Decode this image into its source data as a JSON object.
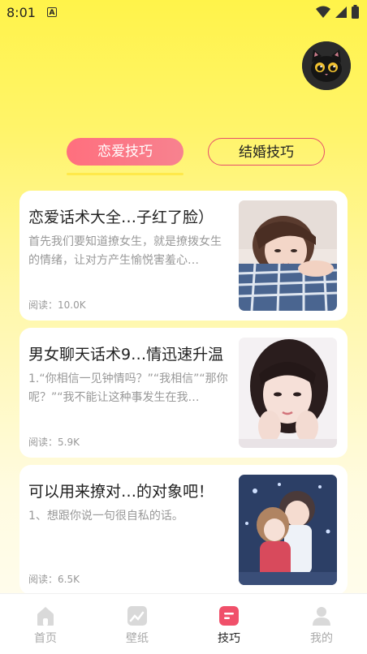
{
  "status_bar": {
    "time": "8:01",
    "notification_icon": "A"
  },
  "tabs": {
    "love": "恋爱技巧",
    "marriage": "结婚技巧"
  },
  "cards": [
    {
      "title": "恋爱话术大全…子红了脸）",
      "desc": "首先我们要知道撩女生，就是撩拨女生的情绪，让对方产生愉悦害羞心…",
      "reads": "阅读：10.0K"
    },
    {
      "title": "男女聊天话术9…情迅速升温",
      "desc": "1.“你相信一见钟情吗？”“我相信”“那你呢？”“我不能让这种事发生在我…",
      "reads": "阅读：5.9K"
    },
    {
      "title": "可以用来撩对…的对象吧！",
      "desc": "1、想跟你说一句很自私的话。",
      "reads": "阅读：6.5K"
    }
  ],
  "nav": {
    "home": "首页",
    "wallpaper": "壁纸",
    "tips": "技巧",
    "mine": "我的"
  },
  "colors": {
    "accent": "#ff6f7e",
    "background_top": "#fff34a",
    "active_nav": "#f0506a"
  }
}
